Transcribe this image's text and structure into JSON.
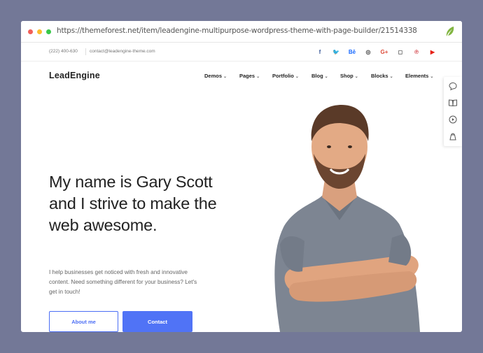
{
  "browser": {
    "url": "https://themeforest.net/item/leadengine-multipurpose-wordpress-theme-with-page-builder/21514338",
    "leaf_icon": "envato-leaf-icon"
  },
  "topbar": {
    "phone": "(222) 400-630",
    "email": "contact@leadengine-theme.com",
    "socials": [
      {
        "icon": "facebook-icon",
        "glyph": "f",
        "color": "#3b5998"
      },
      {
        "icon": "twitter-icon",
        "glyph": "🐦",
        "color": "#1da1f2"
      },
      {
        "icon": "behance-icon",
        "glyph": "Bē",
        "color": "#1769ff"
      },
      {
        "icon": "dribbble-icon",
        "glyph": "◎",
        "color": "#444444"
      },
      {
        "icon": "google-plus-icon",
        "glyph": "G+",
        "color": "#dd4b39"
      },
      {
        "icon": "instagram-icon",
        "glyph": "◻",
        "color": "#666666"
      },
      {
        "icon": "pinterest-icon",
        "glyph": "℗",
        "color": "#cb2027"
      },
      {
        "icon": "youtube-icon",
        "glyph": "▶",
        "color": "#e62117"
      }
    ]
  },
  "nav": {
    "logo": "LeadEngine",
    "items": [
      {
        "label": "Demos"
      },
      {
        "label": "Pages"
      },
      {
        "label": "Portfolio"
      },
      {
        "label": "Blog"
      },
      {
        "label": "Shop"
      },
      {
        "label": "Blocks"
      },
      {
        "label": "Elements"
      }
    ]
  },
  "hero": {
    "heading_lines": [
      "My name is Gary Scott",
      "and I strive to make the",
      "web awesome."
    ],
    "lead_lines": [
      "I help businesses get noticed with fresh and innovative",
      "content. Need something different for your business? Let's",
      "get in touch!"
    ],
    "about_button": "About me",
    "contact_button": "Contact"
  },
  "colors": {
    "accent": "#5073f6",
    "backdrop": "#737897"
  },
  "side_tools": [
    "chat-icon",
    "book-icon",
    "play-icon",
    "bag-icon"
  ]
}
